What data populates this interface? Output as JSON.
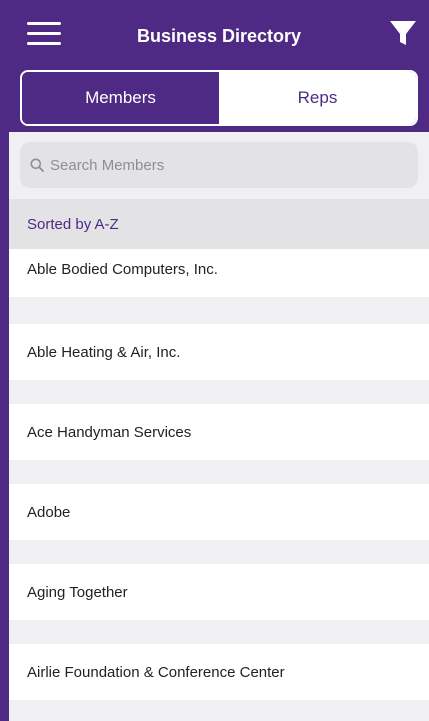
{
  "header": {
    "title": "Business Directory",
    "menu_icon": "hamburger-icon",
    "filter_icon": "filter-funnel-icon"
  },
  "tabs": [
    {
      "label": "Members",
      "selected": true
    },
    {
      "label": "Reps",
      "selected": false
    }
  ],
  "search": {
    "placeholder": "Search Members",
    "value": ""
  },
  "sort_label": "Sorted by A-Z",
  "members": [
    "Able Bodied Computers, Inc.",
    "Able Heating & Air, Inc.",
    "Ace Handyman Services",
    "Adobe",
    "Aging Together",
    "Airlie Foundation & Conference Center"
  ],
  "colors": {
    "brand": "#4e2a84",
    "background": "#f0f0f2",
    "search_bg": "#e3e3e6"
  }
}
